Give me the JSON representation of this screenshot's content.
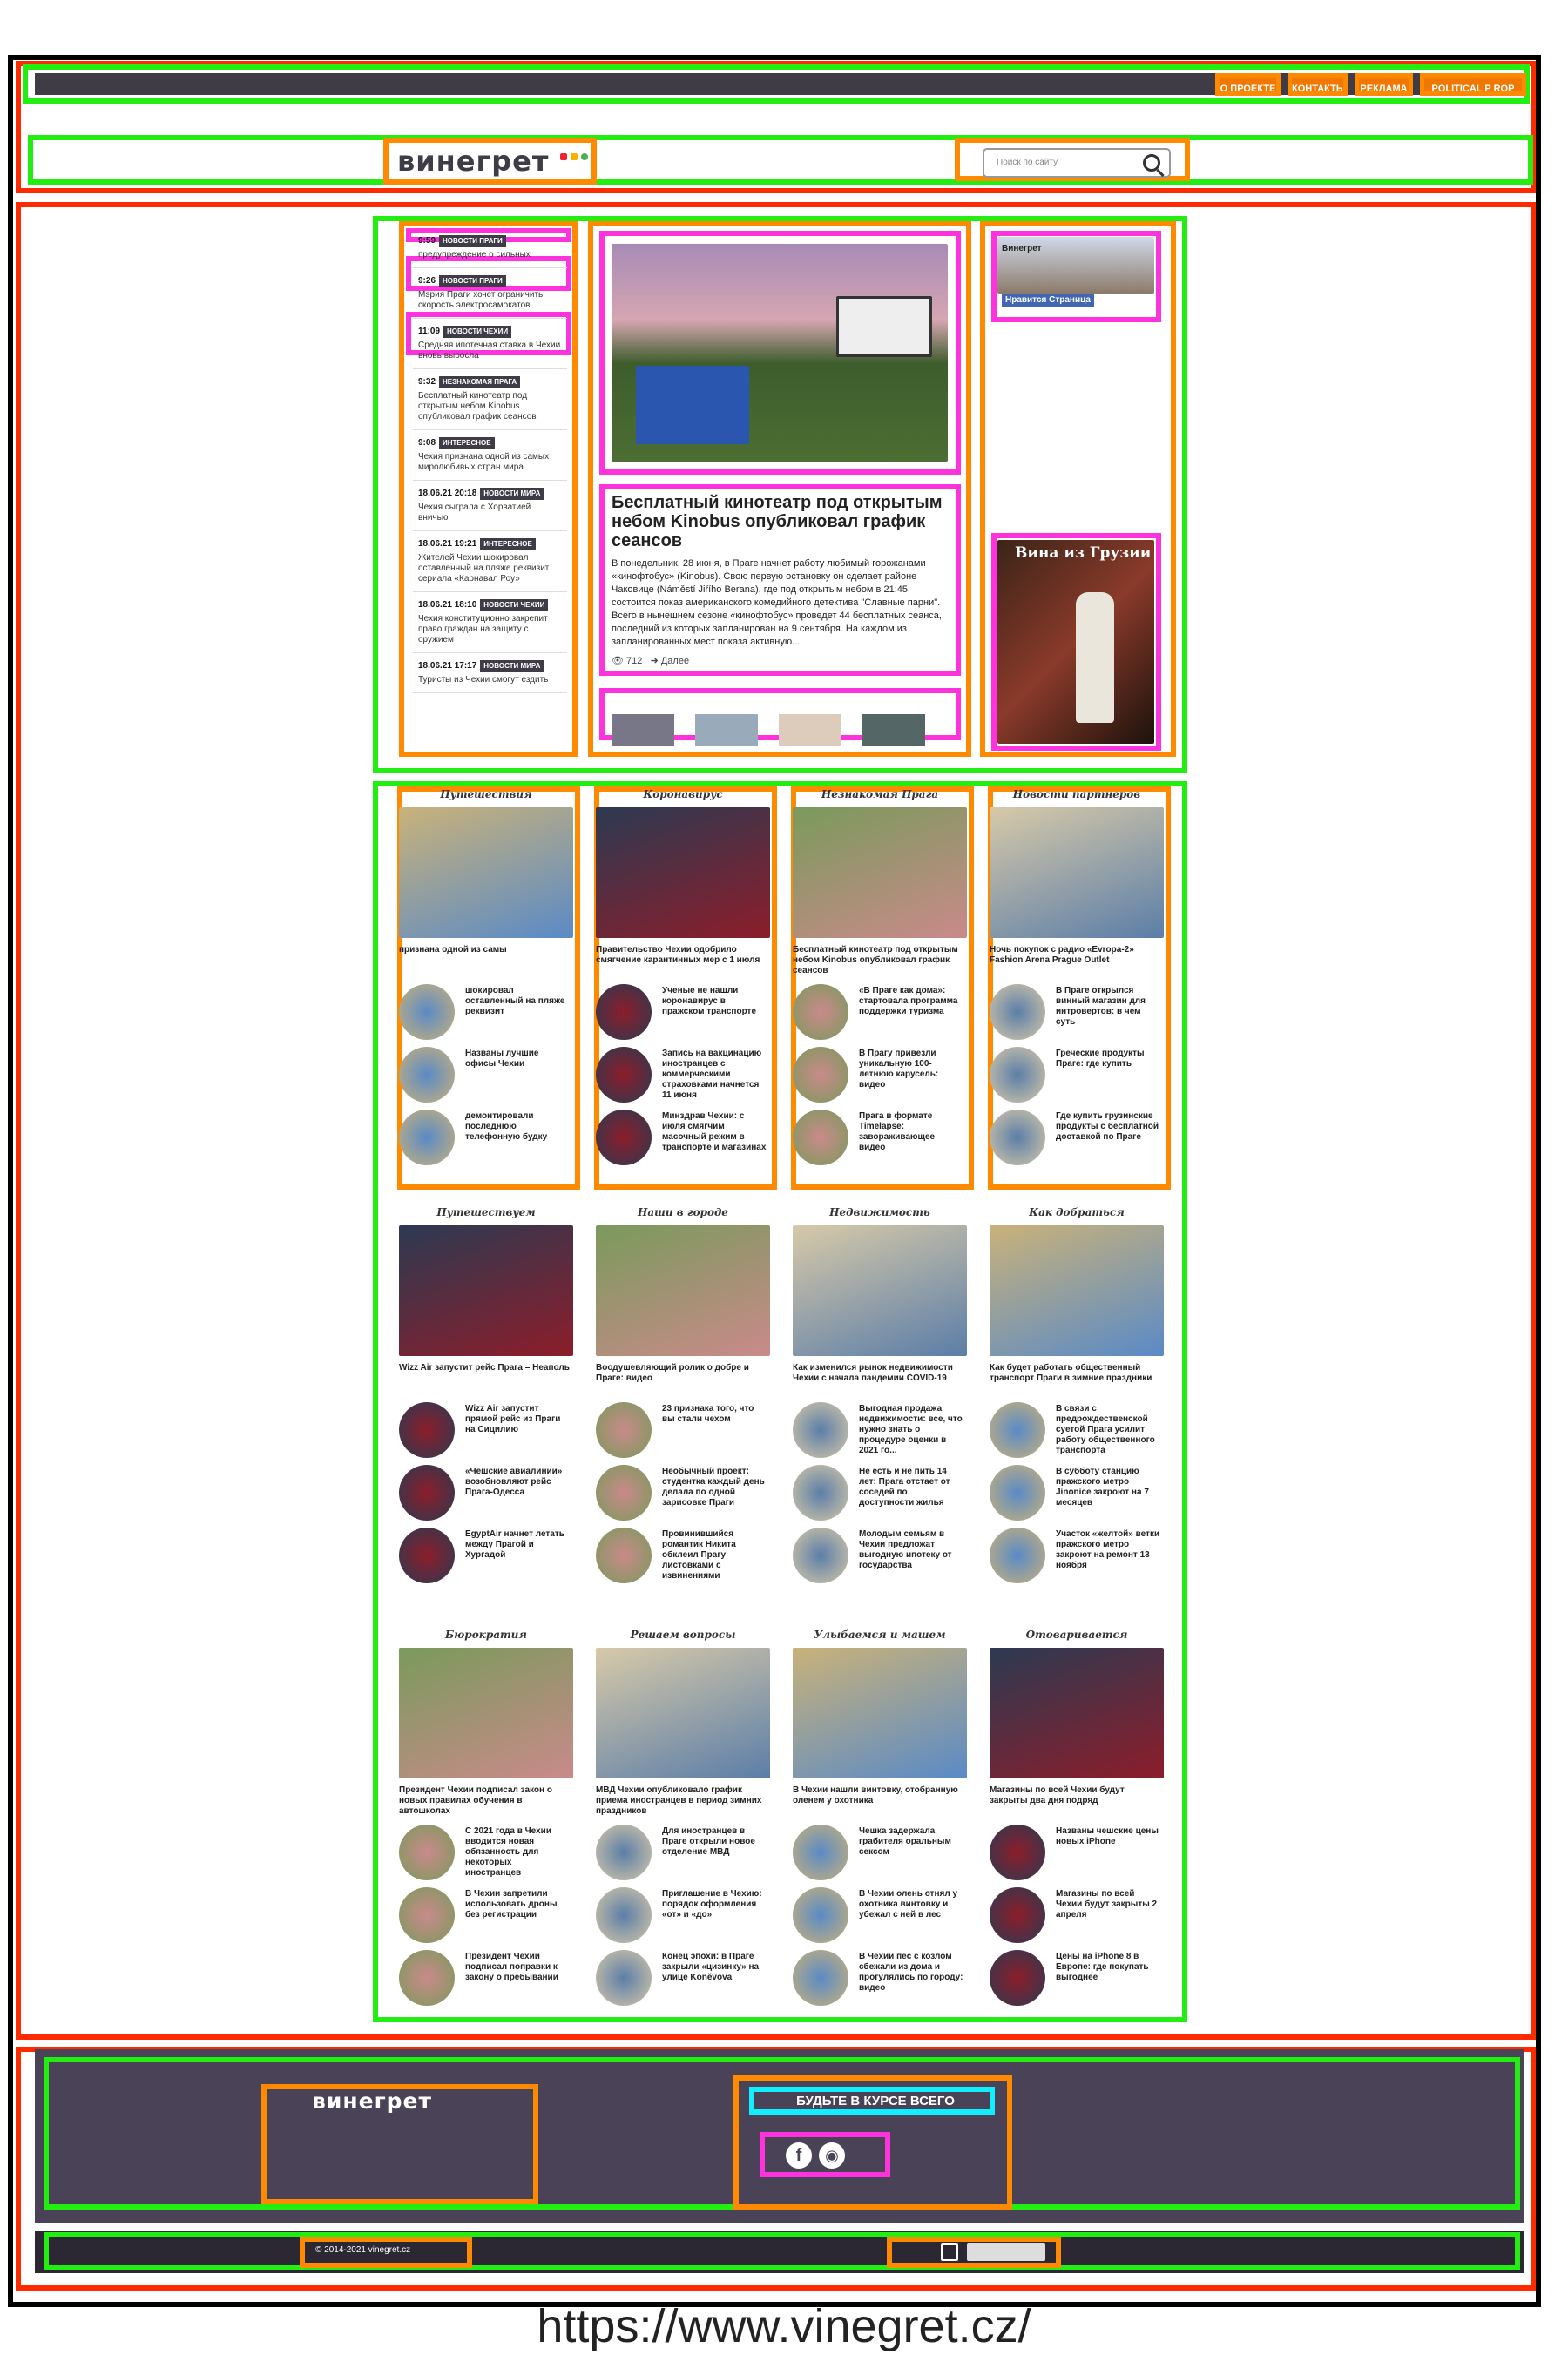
{
  "colors": {
    "accent": "#f07800",
    "dark": "#3f3c48",
    "footer": "#4a4257"
  },
  "nav": {
    "items": [
      "О ПРОЕКТЕ",
      "КОНТАКТЫ",
      "РЕКЛАМА",
      "POLITICAL P ROP"
    ],
    "search_placeholder": "Поиск по сайту"
  },
  "brand": {
    "logo": "винегрет"
  },
  "feed": [
    {
      "time": "9:59",
      "tag": "НОВОСТИ ПРАГИ",
      "text": "предупреждение о сильных"
    },
    {
      "time": "9:26",
      "tag": "НОВОСТИ ПРАГИ",
      "text": "Мэрия Праги хочет ограничить скорость электросамокатов"
    },
    {
      "time": "11:09",
      "tag": "НОВОСТИ ЧЕХИИ",
      "text": "Средняя ипотечная ставка в Чехии вновь выросла"
    },
    {
      "time": "9:32",
      "tag": "НЕЗНАКОМАЯ ПРАГА",
      "text": "Бесплатный кинотеатр под открытым небом Kinobus опубликовал график сеансов"
    },
    {
      "time": "9:08",
      "tag": "ИНТЕРЕСНОЕ",
      "text": "Чехия признана одной из самых миролюбивых стран мира"
    },
    {
      "time": "18.06.21 20:18",
      "tag": "НОВОСТИ МИРА",
      "text": "Чехия сыграла с Хорватией вничью"
    },
    {
      "time": "18.06.21 19:21",
      "tag": "ИНТЕРЕСНОЕ",
      "text": "Жителей Чехии шокировал оставленный на пляже реквизит сериала «Карнавал Роу»"
    },
    {
      "time": "18.06.21 18:10",
      "tag": "НОВОСТИ ЧЕХИИ",
      "text": "Чехия конституционно закрепит право граждан на защиту с оружием"
    },
    {
      "time": "18.06.21 17:17",
      "tag": "НОВОСТИ МИРА",
      "text": "Туристы из Чехии смогут ездить"
    }
  ],
  "main": {
    "title": "Бесплатный кинотеатр под открытым небом Kinobus опубликовал график сеансов",
    "lead": "В понедельник, 28 июня, в Праге начнет работу любимый горожанами «кинофтобус» (Kinobus). Свою первую остановку он сделает районе Чаковице (Náměstí Jiřího Berana), где под открытым небом в 21:45 состоится показ американского комедийного детектива \"Славные парни\". Всего в нынешнем сезоне «кинофтобус» проведет 44 бесплатных сеанса, последний из которых запланирован на 9 сентября. На каждом из запланированных мест показа активную...",
    "views": "712",
    "more": "Далее"
  },
  "sidebar": {
    "fb_like": "Нравится Страница",
    "fb_name": "Винегрет",
    "ad_title": "Вина из Грузии"
  },
  "row1": [
    {
      "title": "Путешествия",
      "lead": "признана одной из самы",
      "items": [
        "шокировал оставленный на пляже реквизит",
        "Названы лучшие офисы Чехии",
        "демонтировали последнюю телефонную будку"
      ]
    },
    {
      "title": "Коронавирус",
      "lead": "Правительство Чехии одобрило смягчение карантинных мер с 1 июля",
      "items": [
        "Ученые не нашли коронавирус в пражском транспорте",
        "Запись на вакцинацию иностранцев с коммерческими страховками начнется 11 июня",
        "Минздрав Чехии: с июля смягчим масочный режим в транспорте и магазинах"
      ]
    },
    {
      "title": "Незнакомая Прага",
      "lead": "Бесплатный кинотеатр под открытым небом Kinobus опубликовал график сеансов",
      "items": [
        "«В Праге как дома»: стартовала программа поддержки туризма",
        "В Прагу привезли уникальную 100-летнюю карусель: видео",
        "Прага в формате Timelapse: завораживающее видео"
      ]
    },
    {
      "title": "Новости партнеров",
      "lead": "Ночь покупок с радио «Evropa-2» Fashion Arena Prague Outlet",
      "items": [
        "В Праге открылся винный магазин для интровертов: в чем суть",
        "Греческие продукты Праге: где купить",
        "Где купить грузинские продукты с бесплатной доставкой по Праге"
      ]
    }
  ],
  "row2": [
    {
      "title": "Путешествуем",
      "lead": "Wizz Air запустит рейс Прага – Неаполь",
      "items": [
        "Wizz Air запустит прямой рейс из Праги на Сицилию",
        "«Чешские авиалинии» возобновляют рейс Прага-Одесса",
        "EgyptAir начнет летать между Прагой и Хургадой"
      ]
    },
    {
      "title": "Наши в городе",
      "lead": "Воодушевляющий ролик о добре и Праге: видео",
      "items": [
        "23 признака того, что вы стали чехом",
        "Необычный проект: студентка каждый день делала по одной зарисовке Праги",
        "Провинившийся романтик Никита обклеил Прагу листовками с извинениями"
      ]
    },
    {
      "title": "Недвижимость",
      "lead": "Как изменился рынок недвижимости Чехии с начала пандемии COVID-19",
      "items": [
        "Выгодная продажа недвижимости: все, что нужно знать о процедуре оценки в 2021 го...",
        "Не есть и не пить 14 лет: Прага отстает от соседей по доступности жилья",
        "Молодым семьям в Чехии предложат выгодную ипотеку от государства"
      ]
    },
    {
      "title": "Как добраться",
      "lead": "Как будет работать общественный транспорт Праги в зимние праздники",
      "items": [
        "В связи с предрождественской суетой Прага усилит работу общественного транспорта",
        "В субботу станцию пражского метро Jinonice закроют на 7 месяцев",
        "Участок «желтой» ветки пражского метро закроют на ремонт 13 ноября"
      ]
    }
  ],
  "row3": [
    {
      "title": "Бюрократия",
      "lead": "Президент Чехии подписал закон о новых правилах обучения в автошколах",
      "items": [
        "С 2021 года в Чехии вводится новая обязанность для некоторых иностранцев",
        "В Чехии запретили использовать дроны без регистрации",
        "Президент Чехии подписал поправки к закону о пребывании"
      ]
    },
    {
      "title": "Решаем вопросы",
      "lead": "МВД Чехии опубликовало график приема иностранцев в период зимних праздников",
      "items": [
        "Для иностранцев в Праге открыли новое отделение МВД",
        "Приглашение в Чехию: порядок оформления «от» и «до»",
        "Конец эпохи: в Праге закрыли «цизинку» на улице Koněvova"
      ]
    },
    {
      "title": "Улыбаемся и машем",
      "lead": "В Чехии нашли винтовку, отобранную оленем у охотника",
      "items": [
        "Чешка задержала грабителя оральным сексом",
        "В Чехии олень отнял у охотника винтовку и убежал с ней в лес",
        "В Чехии пёс с козлом сбежали из дома и прогулялись по городу: видео"
      ]
    },
    {
      "title": "Отоваривается",
      "lead": "Магазины по всей Чехии будут закрыты два дня подряд",
      "items": [
        "Названы чешские цены новых iPhone",
        "Магазины по всей Чехии будут закрыты 2 апреля",
        "Цены на iPhone 8 в Европе: где покупать выгоднее"
      ]
    }
  ],
  "footer": {
    "logo": "винегрет",
    "subscribe": "БУДЬТЕ В КУРСЕ ВСЕГО НОВОГО",
    "copyright": "© 2014-2021 vinegret.cz"
  },
  "url": "https://www.vinegret.cz/"
}
